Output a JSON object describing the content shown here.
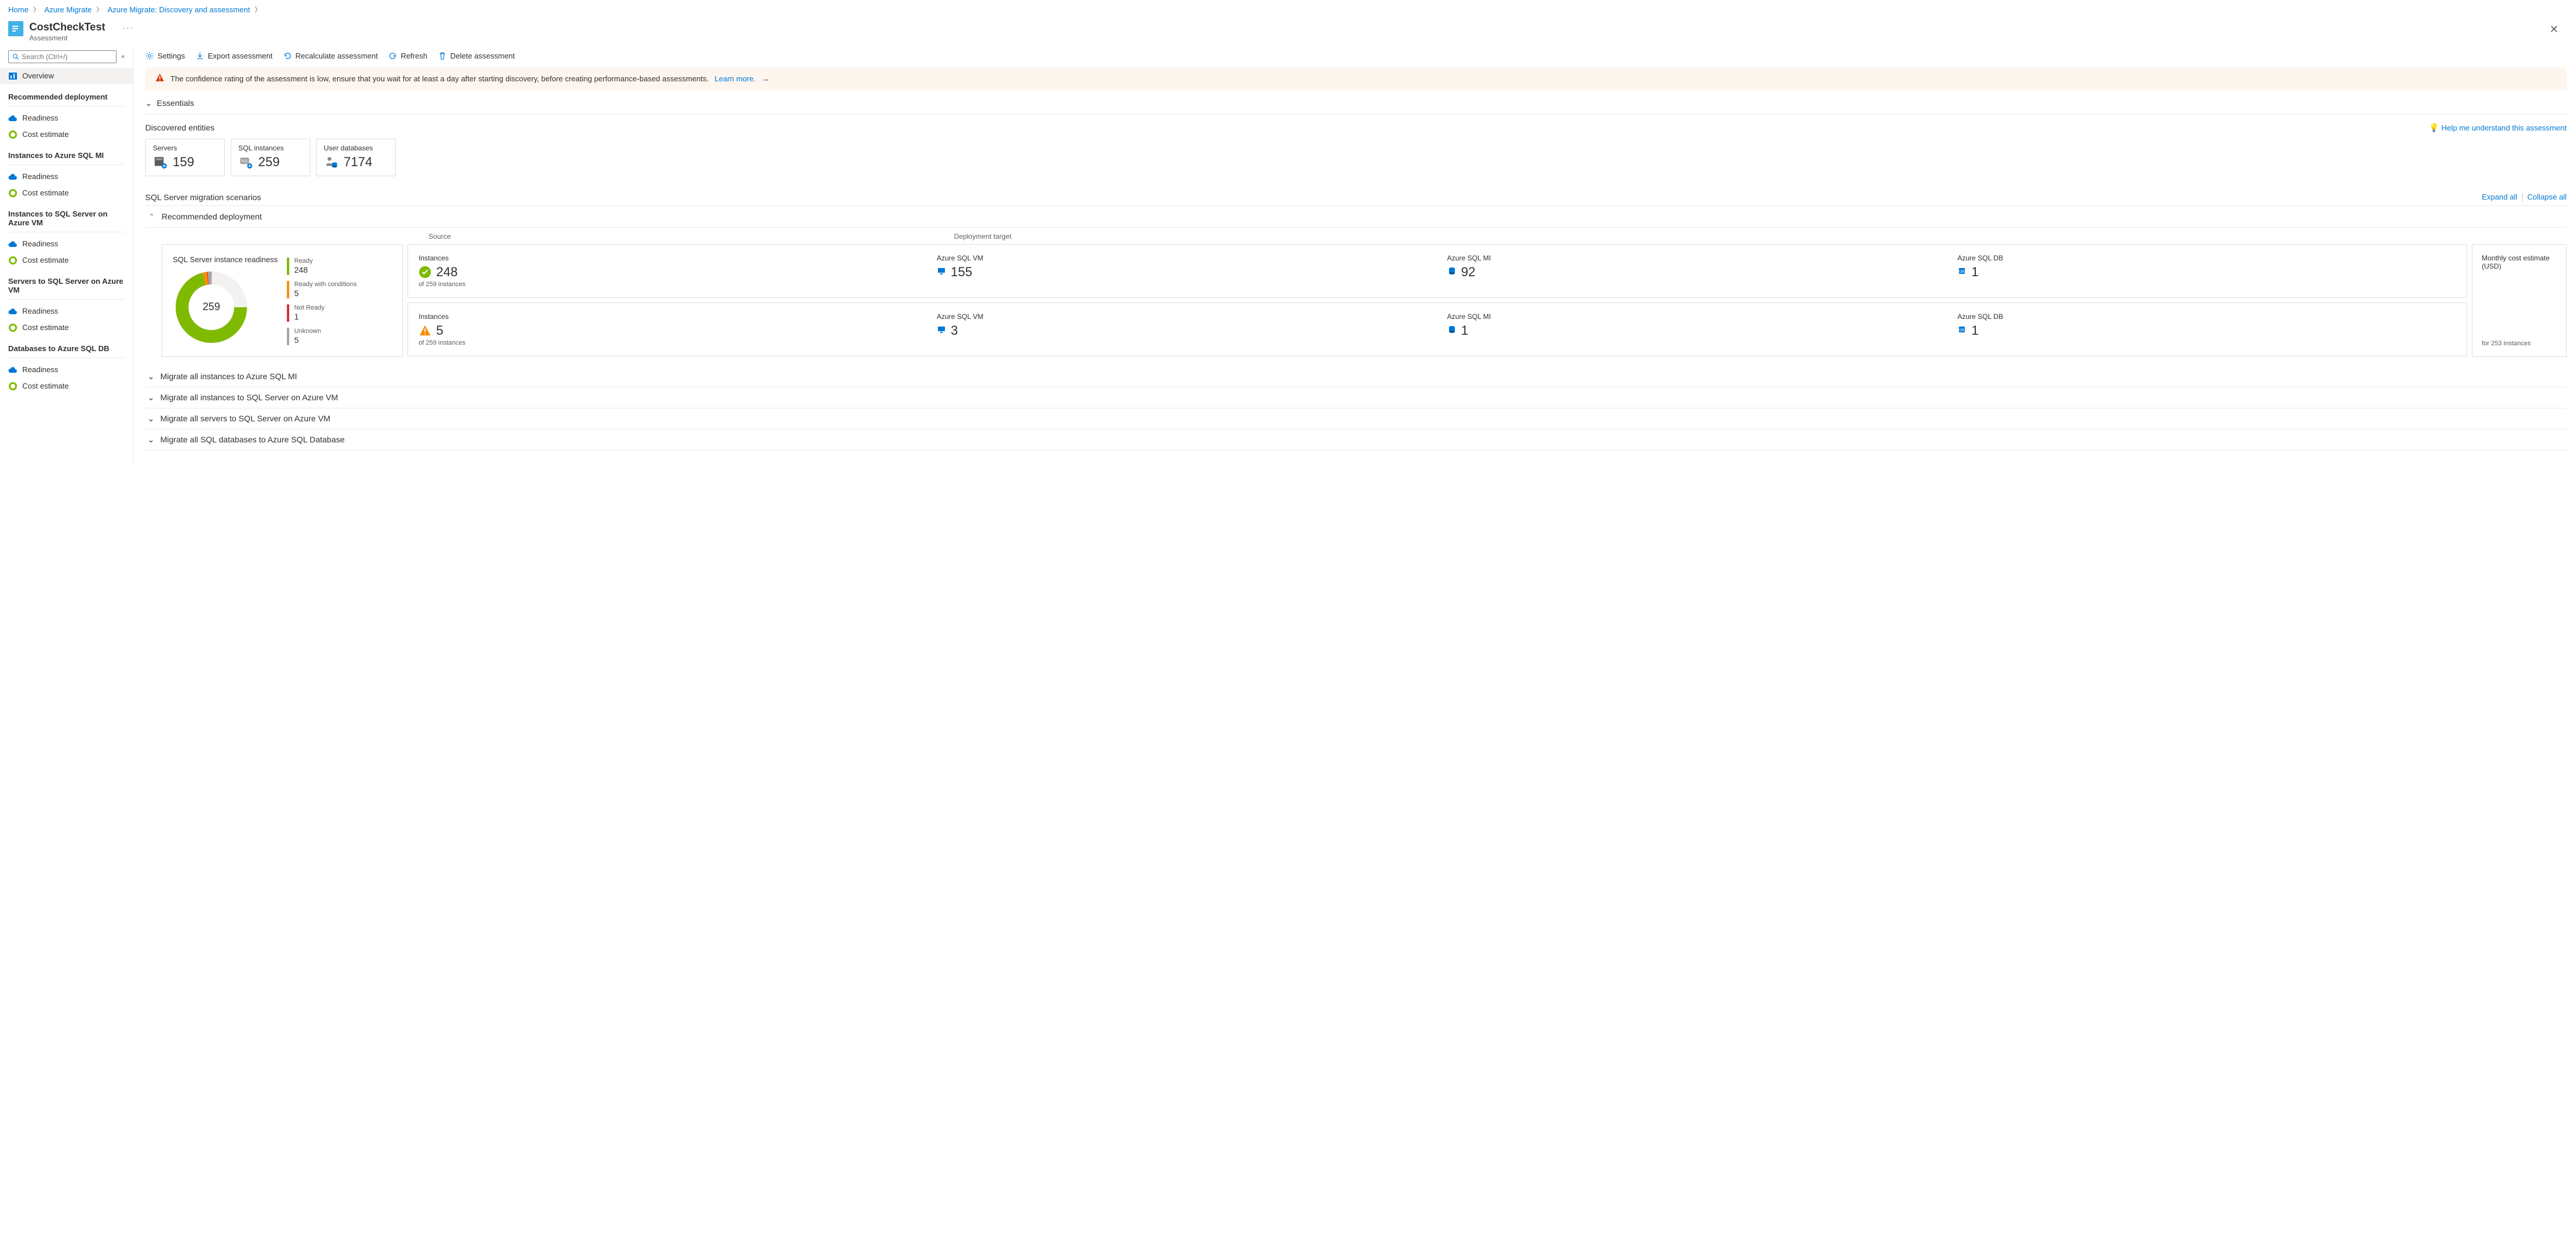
{
  "breadcrumbs": [
    "Home",
    "Azure Migrate",
    "Azure Migrate: Discovery and assessment"
  ],
  "title": "CostCheckTest",
  "subtitle": "Assessment",
  "search_placeholder": "Search (Ctrl+/)",
  "sidebar": {
    "overview": "Overview",
    "sections": [
      {
        "title": "Recommended deployment",
        "items": [
          "Readiness",
          "Cost estimate"
        ]
      },
      {
        "title": "Instances to Azure SQL MI",
        "items": [
          "Readiness",
          "Cost estimate"
        ]
      },
      {
        "title": "Instances to SQL Server on Azure VM",
        "items": [
          "Readiness",
          "Cost estimate"
        ]
      },
      {
        "title": "Servers to SQL Server on Azure VM",
        "items": [
          "Readiness",
          "Cost estimate"
        ]
      },
      {
        "title": "Databases to Azure SQL DB",
        "items": [
          "Readiness",
          "Cost estimate"
        ]
      }
    ]
  },
  "toolbar": {
    "settings": "Settings",
    "export": "Export assessment",
    "recalc": "Recalculate assessment",
    "refresh": "Refresh",
    "delete": "Delete assessment"
  },
  "warning": {
    "text": "The confidence rating of the assessment is low, ensure that you wait for at least a day after starting discovery, before creating performance-based assessments.",
    "link": "Learn more."
  },
  "essentials": "Essentials",
  "discovered": {
    "title": "Discovered entities",
    "help": "Help me understand this assessment",
    "cards": [
      {
        "label": "Servers",
        "value": "159"
      },
      {
        "label": "SQL instances",
        "value": "259"
      },
      {
        "label": "User databases",
        "value": "7174"
      }
    ]
  },
  "scenarios": {
    "title": "SQL Server migration scenarios",
    "expand": "Expand all",
    "collapse": "Collapse all",
    "recommended": "Recommended deployment",
    "source_label": "Source",
    "target_label": "Deployment target",
    "readiness_title": "SQL Server instance readiness",
    "donut_total": "259",
    "legend": [
      {
        "label": "Ready",
        "value": "248",
        "color": "#7fba00"
      },
      {
        "label": "Ready with conditions",
        "value": "5",
        "color": "#ff8c00"
      },
      {
        "label": "Not Ready",
        "value": "1",
        "color": "#d13438"
      },
      {
        "label": "Unknown",
        "value": "5",
        "color": "#a6a6a6"
      }
    ],
    "ready_row": {
      "instances_label": "Instances",
      "instances_value": "248",
      "instances_sub": "of 259 instances",
      "targets": [
        {
          "label": "Azure SQL VM",
          "value": "155"
        },
        {
          "label": "Azure SQL MI",
          "value": "92"
        },
        {
          "label": "Azure SQL DB",
          "value": "1"
        }
      ]
    },
    "warn_row": {
      "instances_label": "Instances",
      "instances_value": "5",
      "instances_sub": "of 259 instances",
      "targets": [
        {
          "label": "Azure SQL VM",
          "value": "3"
        },
        {
          "label": "Azure SQL MI",
          "value": "1"
        },
        {
          "label": "Azure SQL DB",
          "value": "1"
        }
      ]
    },
    "cost": {
      "label": "Monthly cost estimate (USD)",
      "sub": "for 253 instances"
    },
    "rows": [
      "Migrate all instances to Azure SQL MI",
      "Migrate all instances to SQL Server on Azure VM",
      "Migrate all servers to SQL Server on Azure VM",
      "Migrate all SQL databases to Azure SQL Database"
    ]
  },
  "chart_data": {
    "type": "pie",
    "title": "SQL Server instance readiness",
    "total": 259,
    "series": [
      {
        "name": "Ready",
        "value": 248
      },
      {
        "name": "Ready with conditions",
        "value": 5
      },
      {
        "name": "Not Ready",
        "value": 1
      },
      {
        "name": "Unknown",
        "value": 5
      }
    ]
  }
}
